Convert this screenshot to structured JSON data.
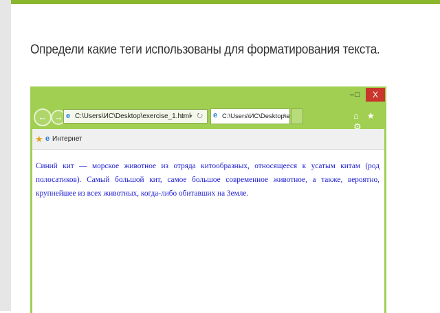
{
  "question": "Определи какие теги использованы для форматирования текста.",
  "window": {
    "controls": {
      "minimize": "–",
      "maximize": "□",
      "close": "X"
    },
    "address_bar": "C:\\Users\\ИС\\Desktop\\exercise_1.html",
    "address_tools": "⌕ ▾ ↻",
    "tab_title": "C:\\Users\\ИС\\Desktop\\exerc...",
    "tab_close": "×",
    "right_icons": "⌂ ★ ⚙",
    "favorites_label": "Интернет",
    "content_text": "Синий кит — морское животное из отряда китообразных, относящееся к усатым китам (род полосатиков). Самый большой кит, самое большое современное животное, а также, вероятно, крупнейшее из всех животных, когда-либо обитавших на Земле."
  },
  "colors": {
    "accent": "#8ab72d",
    "window_frame": "#a0cf52",
    "content_text": "#1a1ad0",
    "close_button": "#c9372c"
  },
  "icons": [
    "back-arrow-icon",
    "forward-arrow-icon",
    "ie-page-icon",
    "search-icon",
    "refresh-icon",
    "tab-close-icon",
    "home-icon",
    "star-icon",
    "gear-icon",
    "favorites-star-icon"
  ]
}
